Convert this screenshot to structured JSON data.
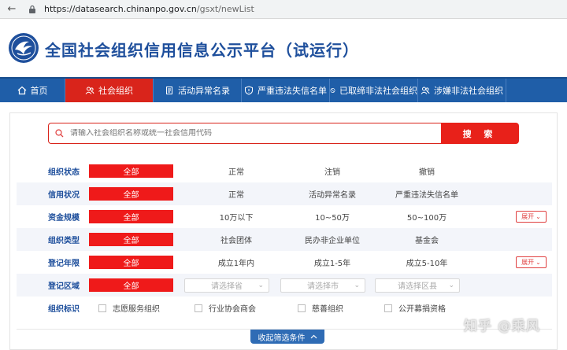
{
  "browser": {
    "url_host": "https://datasearch.chinanpo.gov.cn",
    "url_path": "/gsxt/newList"
  },
  "header": {
    "title": "全国社会组织信用信息公示平台（试运行）"
  },
  "nav": {
    "items": [
      {
        "label": "首页",
        "icon": "home-icon"
      },
      {
        "label": "社会组织",
        "icon": "people-icon"
      },
      {
        "label": "活动异常名录",
        "icon": "document-icon"
      },
      {
        "label": "严重违法失信名单",
        "icon": "shield-icon"
      },
      {
        "label": "已取缔非法社会组织",
        "icon": "ban-icon"
      },
      {
        "label": "涉嫌非法社会组织",
        "icon": "people-icon"
      }
    ]
  },
  "search": {
    "placeholder": "请输入社会组织名称或统一社会信用代码",
    "button_label": "搜 索"
  },
  "filters": {
    "all_label": "全部",
    "expand_label": "展开",
    "status": {
      "label": "组织状态",
      "options": [
        "正常",
        "注销",
        "撤销"
      ]
    },
    "credit": {
      "label": "信用状况",
      "options": [
        "正常",
        "活动异常名录",
        "严重违法失信名单"
      ]
    },
    "funds": {
      "label": "资金规模",
      "options": [
        "10万以下",
        "10~50万",
        "50~100万"
      ]
    },
    "type": {
      "label": "组织类型",
      "options": [
        "社会团体",
        "民办非企业单位",
        "基金会"
      ]
    },
    "years": {
      "label": "登记年限",
      "options": [
        "成立1年内",
        "成立1-5年",
        "成立5-10年"
      ]
    },
    "region": {
      "label": "登记区域",
      "selects": [
        "请选择省",
        "请选择市",
        "请选择区县"
      ]
    },
    "tags": {
      "label": "组织标识",
      "options": [
        "志愿服务组织",
        "行业协会商会",
        "慈善组织",
        "公开募捐资格"
      ]
    }
  },
  "collapse_label": "收起筛选条件",
  "watermark": "知乎 @乘风",
  "colors": {
    "brand_blue": "#1f5ea8",
    "accent_red": "#e8211a",
    "label_blue": "#1e4f9c"
  }
}
